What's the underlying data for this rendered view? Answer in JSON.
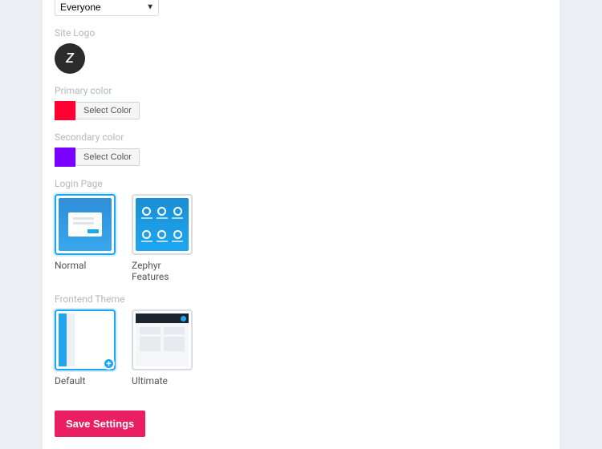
{
  "select": {
    "value": "Everyone"
  },
  "labels": {
    "siteLogo": "Site Logo",
    "primaryColor": "Primary color",
    "secondaryColor": "Secondary color",
    "selectColor": "Select Color",
    "loginPage": "Login Page",
    "frontendTheme": "Frontend Theme",
    "save": "Save Settings"
  },
  "logo": {
    "text": "Z",
    "bg": "#2b2b2b"
  },
  "colors": {
    "primary": "#ff0033",
    "secondary": "#7a00ff"
  },
  "loginPage": {
    "options": [
      {
        "key": "normal",
        "label": "Normal",
        "selected": true
      },
      {
        "key": "zephyr",
        "label": "Zephyr Features",
        "selected": false
      }
    ]
  },
  "frontendTheme": {
    "options": [
      {
        "key": "default",
        "label": "Default",
        "selected": true
      },
      {
        "key": "ultimate",
        "label": "Ultimate",
        "selected": false
      }
    ]
  },
  "icons": {
    "plus": "+"
  }
}
